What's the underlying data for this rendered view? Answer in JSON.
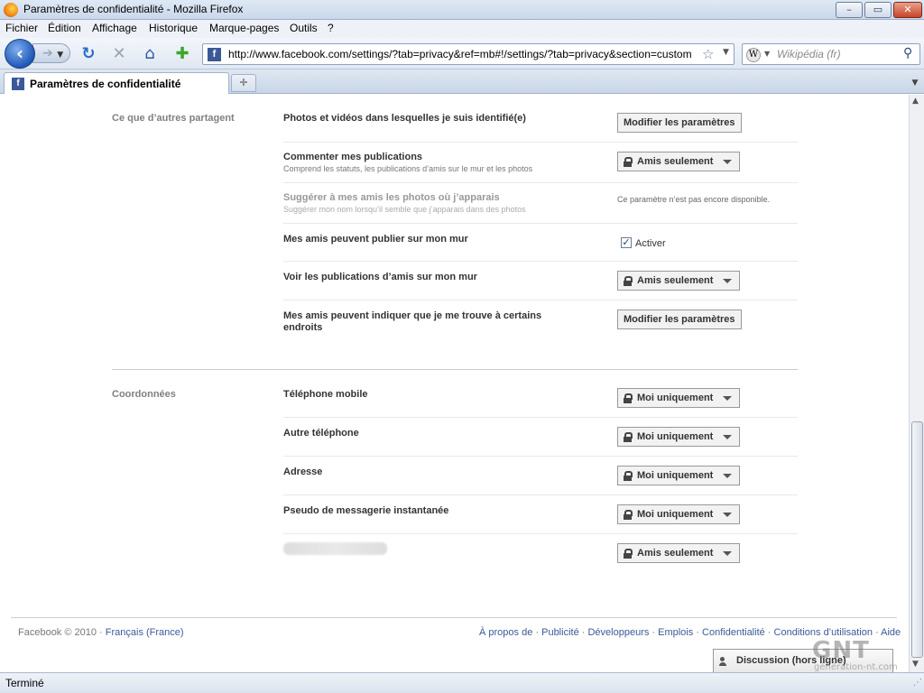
{
  "window": {
    "title": "Paramètres de confidentialité - Mozilla Firefox",
    "controls": {
      "minimize": "–",
      "maximize": "▭",
      "close": "✕"
    }
  },
  "menu": [
    "Fichier",
    "Édition",
    "Affichage",
    "Historique",
    "Marque-pages",
    "Outils",
    "?"
  ],
  "toolbar": {
    "url": "http://www.facebook.com/settings/?tab=privacy&ref=mb#!/settings/?tab=privacy&section=custom",
    "search_placeholder": "Wikipédia (fr)",
    "icons": [
      "back-icon",
      "forward-icon",
      "reload-icon",
      "stop-icon",
      "home-icon",
      "add-bookmark-icon",
      "bookmark-star-icon",
      "search-icon"
    ]
  },
  "tabs": [
    {
      "label": "Paramètres de confidentialité",
      "active": true
    }
  ],
  "sharing_section": {
    "label": "Ce que d’autres partagent",
    "rows": [
      {
        "title": "Photos et vidéos dans lesquelles je suis identifié(e)",
        "control": "button",
        "value": "Modifier les paramètres"
      },
      {
        "title": "Commenter mes publications",
        "subtitle": "Comprend les statuts, les publications d’amis sur le mur et les photos",
        "control": "dropdown",
        "value": "Amis seulement"
      },
      {
        "title": "Suggérer à mes amis les photos où j’apparais",
        "subtitle": "Suggérer mon nom lorsqu’il semble que j’apparais dans des photos",
        "control": "note",
        "value": "Ce paramètre n’est pas encore disponible.",
        "disabled": true
      },
      {
        "title": "Mes amis peuvent publier sur mon mur",
        "control": "checkbox",
        "value": "Activer",
        "checked": true
      },
      {
        "title": "Voir les publications d’amis sur mon mur",
        "control": "dropdown",
        "value": "Amis seulement"
      },
      {
        "title": "Mes amis peuvent indiquer que je me trouve à certains endroits",
        "control": "button",
        "value": "Modifier les paramètres"
      }
    ]
  },
  "contact_section": {
    "label": "Coordonnées",
    "rows": [
      {
        "title": "Téléphone mobile",
        "value": "Moi uniquement"
      },
      {
        "title": "Autre téléphone",
        "value": "Moi uniquement"
      },
      {
        "title": "Adresse",
        "value": "Moi uniquement"
      },
      {
        "title": "Pseudo de messagerie instantanée",
        "value": "Moi uniquement"
      },
      {
        "title": "",
        "value": "Amis seulement",
        "redacted": true
      }
    ]
  },
  "footer": {
    "copyright": "Facebook © 2010 · ",
    "language": "Français (France)",
    "links": [
      "À propos de",
      "Publicité",
      "Développeurs",
      "Emplois",
      "Confidentialité",
      "Conditions d’utilisation",
      "Aide"
    ],
    "separator": " · "
  },
  "chat": {
    "label": "Discussion (hors ligne)"
  },
  "status": {
    "text": "Terminé"
  },
  "watermark": {
    "logo": "GNT",
    "site": "génération-nt.com"
  }
}
